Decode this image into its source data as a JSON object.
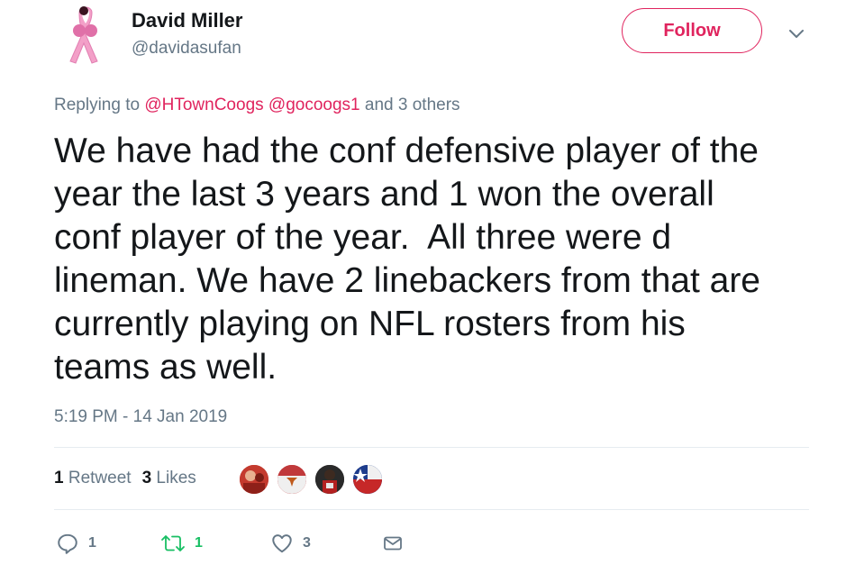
{
  "author": {
    "name": "David Miller",
    "handle": "@davidasufan",
    "avatar_icon": "pink-ribbon-boxing-gloves-icon"
  },
  "follow_label": "Follow",
  "colors": {
    "accent": "#e0245e",
    "muted": "#657786",
    "text": "#14171a",
    "retweet": "#17bf63",
    "divider": "#e6ecf0"
  },
  "replying": {
    "prefix": "Replying to",
    "mention1": "@HTownCoogs",
    "mention2": "@gocoogs1",
    "suffix": "and 3 others"
  },
  "tweet_text": "We have had the conf defensive player of the\nyear the last 3 years and 1 won the overall\nconf player of the year.  All three were d\nlineman. We have 2 linebackers from that are\ncurrently playing on NFL rosters from his\nteams as well.",
  "timestamp": "5:19 PM - 14 Jan 2019",
  "stats": {
    "retweet_count": "1",
    "retweet_label": "Retweet",
    "likes_count": "3",
    "likes_label": "Likes"
  },
  "likers": [
    {
      "icon": "liker-avatar-1",
      "color": "#b5302a"
    },
    {
      "icon": "liker-avatar-2",
      "color": "#c0393b"
    },
    {
      "icon": "liker-avatar-3",
      "color": "#2d2d2d"
    },
    {
      "icon": "liker-avatar-4",
      "color": "#1f3f8f"
    }
  ],
  "actions": {
    "reply_count": "1",
    "retweet_count": "1",
    "like_count": "3"
  }
}
